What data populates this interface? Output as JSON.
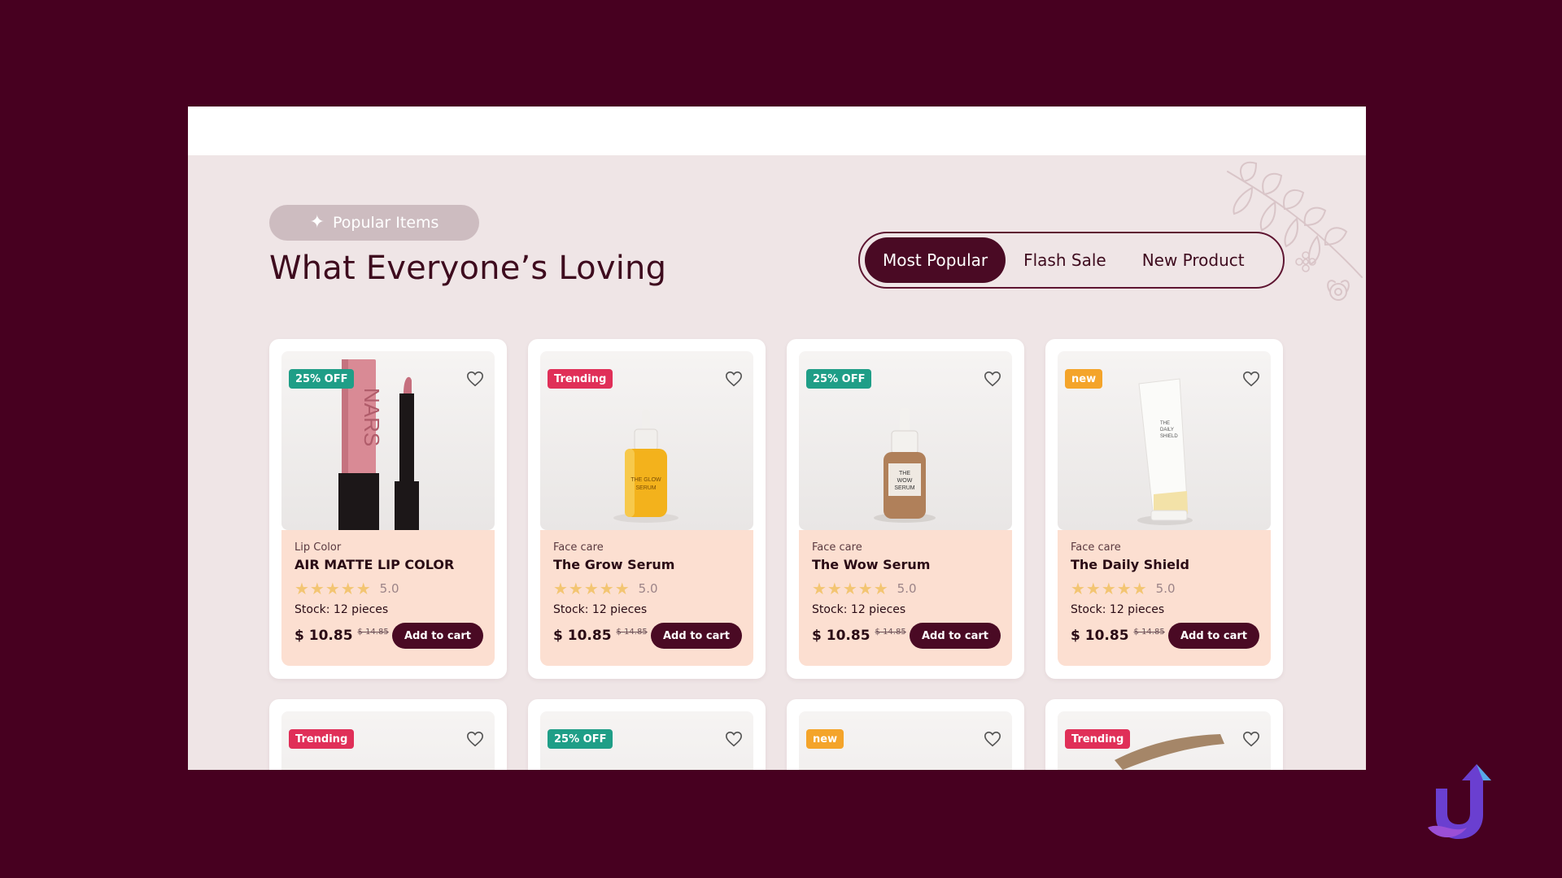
{
  "section": {
    "badge_label": "Popular Items",
    "title": "What Everyone’s Loving"
  },
  "tabs": [
    {
      "label": "Most Popular",
      "active": true
    },
    {
      "label": "Flash Sale",
      "active": false
    },
    {
      "label": "New Product",
      "active": false
    }
  ],
  "products": [
    {
      "badge": "25% OFF",
      "category": "Lip Color",
      "name": "AIR MATTE LIP COLOR",
      "stars": "★★★★★",
      "rating": "5.0",
      "stock_label": "Stock:",
      "stock_value": "12 pieces",
      "price": "$ 10.85",
      "old_price": "$ 14.85",
      "button": "Add to cart"
    },
    {
      "badge": "Trending",
      "category": "Face care",
      "name": "The Grow Serum",
      "stars": "★★★★★",
      "rating": "5.0",
      "stock_label": "Stock:",
      "stock_value": "12 pieces",
      "price": "$ 10.85",
      "old_price": "$ 14.85",
      "button": "Add to cart"
    },
    {
      "badge": "25% OFF",
      "category": "Face care",
      "name": "The Wow Serum",
      "stars": "★★★★★",
      "rating": "5.0",
      "stock_label": "Stock:",
      "stock_value": "12 pieces",
      "price": "$ 10.85",
      "old_price": "$ 14.85",
      "button": "Add to cart"
    },
    {
      "badge": "new",
      "category": "Face care",
      "name": "The Daily Shield",
      "stars": "★★★★★",
      "rating": "5.0",
      "stock_label": "Stock:",
      "stock_value": "12 pieces",
      "price": "$ 10.85",
      "old_price": "$ 14.85",
      "button": "Add to cart"
    }
  ],
  "next_row_badges": [
    "Trending",
    "25% OFF",
    "new",
    "Trending"
  ],
  "colors": {
    "backdrop": "#470020",
    "primary": "#4a0a24",
    "card_info": "#fcdfd1",
    "badge_teal": "#1f9e87",
    "badge_pink": "#e02f58",
    "badge_orange": "#f4a42a",
    "star": "#f3c572"
  },
  "icons": [
    "sparkle-icon",
    "heart-icon",
    "star-icon",
    "flower-icon",
    "leaf-branch-icon"
  ]
}
